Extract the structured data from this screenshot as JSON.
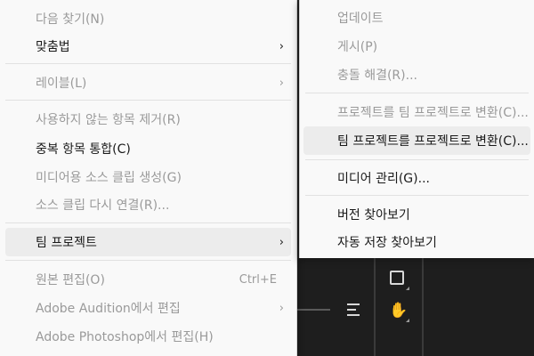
{
  "main_menu": {
    "items": [
      {
        "label": "다음 찾기(N)",
        "disabled": true
      },
      {
        "label": "맞춤법",
        "disabled": false,
        "submenu": true
      },
      {
        "label": "레이블(L)",
        "disabled": true,
        "submenu": true
      },
      {
        "label": "사용하지 않는 항목 제거(R)",
        "disabled": true
      },
      {
        "label": "중복 항목 통합(C)",
        "disabled": false
      },
      {
        "label": "미디어용 소스 클립 생성(G)",
        "disabled": true
      },
      {
        "label": "소스 클립 다시 연결(R)...",
        "disabled": true
      },
      {
        "label": "팀 프로젝트",
        "disabled": false,
        "submenu": true,
        "highlighted": true
      },
      {
        "label": "원본 편집(O)",
        "disabled": true,
        "shortcut": "Ctrl+E"
      },
      {
        "label": "Adobe Audition에서 편집",
        "disabled": true,
        "submenu": true
      },
      {
        "label": "Adobe Photoshop에서 편집(H)",
        "disabled": true
      }
    ],
    "submenu_arrow": "›"
  },
  "team_project_submenu": {
    "items": [
      {
        "label": "업데이트",
        "disabled": true
      },
      {
        "label": "게시(P)",
        "disabled": true
      },
      {
        "label": "충돌 해결(R)...",
        "disabled": true
      },
      {
        "label": "프로젝트를 팀 프로젝트로 변환(C)...",
        "disabled": true
      },
      {
        "label": "팀 프로젝트를 프로젝트로 변환(C)...",
        "disabled": false,
        "highlighted": true
      },
      {
        "label": "미디어 관리(G)...",
        "disabled": false
      },
      {
        "label": "버전 찾아보기",
        "disabled": false
      },
      {
        "label": "자동 저장 찾아보기",
        "disabled": false
      }
    ]
  },
  "tools": {
    "hand_icon": "✋"
  }
}
